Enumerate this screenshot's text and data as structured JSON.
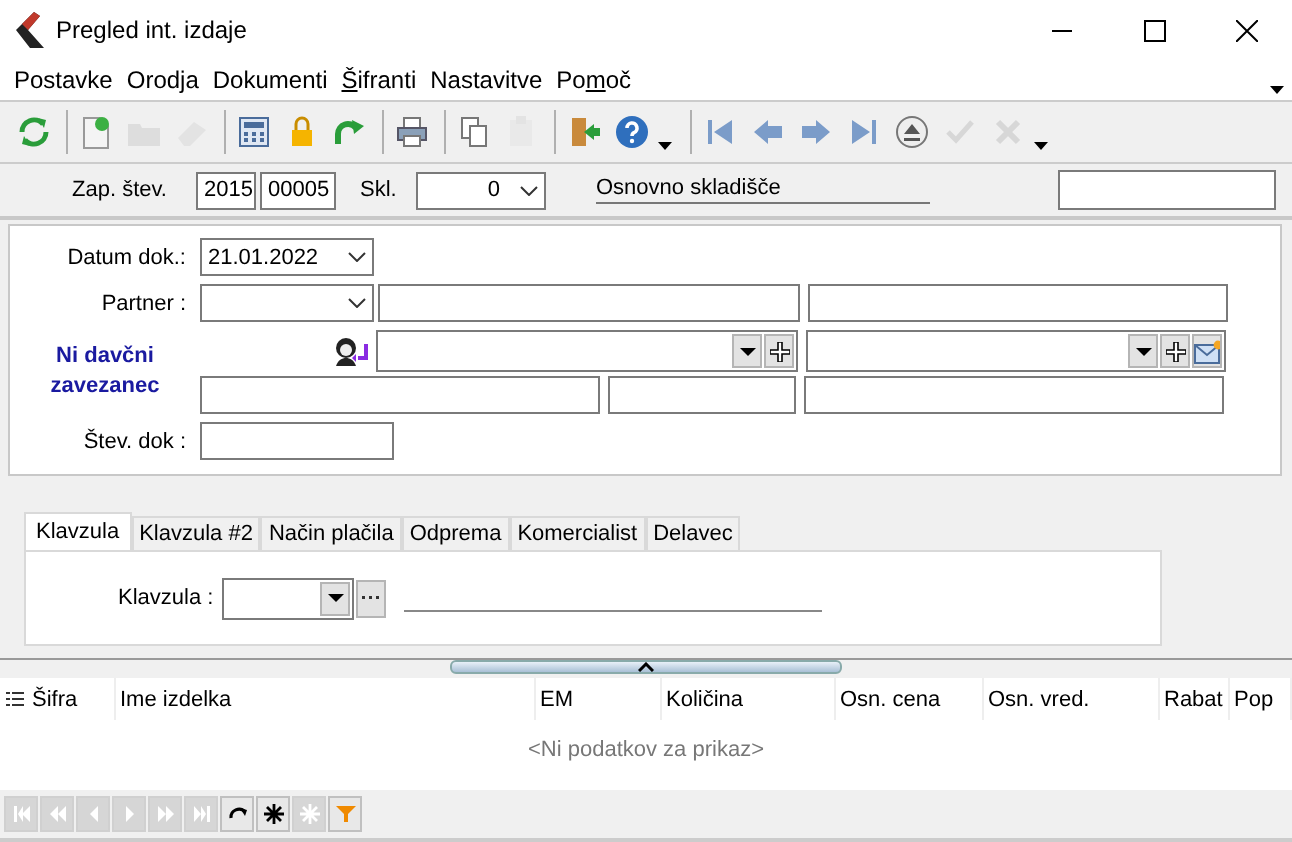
{
  "window": {
    "title": "Pregled int. izdaje"
  },
  "menu": [
    {
      "label": "Postavke"
    },
    {
      "label": "Orodja"
    },
    {
      "label": "Dokumenti"
    },
    {
      "segments": [
        {
          "text": "Š",
          "underlined": true
        },
        {
          "text": "ifranti",
          "underlined": false
        }
      ]
    },
    {
      "label": "Nastavitve"
    },
    {
      "segments": [
        {
          "text": "Po",
          "underlined": false
        },
        {
          "text": "m",
          "underlined": true
        },
        {
          "text": "oč",
          "underlined": false
        }
      ]
    }
  ],
  "toolbar": [
    {
      "disabled": false
    },
    {
      "disabled": false
    },
    {
      "disabled": true
    },
    {
      "disabled": true
    },
    {
      "disabled": false
    },
    {
      "disabled": false
    },
    {
      "disabled": false
    },
    {
      "disabled": false
    },
    {
      "disabled": false
    },
    {
      "disabled": true
    },
    {
      "disabled": false
    },
    {
      "disabled": false
    },
    {
      "disabled": false
    },
    {
      "disabled": false
    },
    {
      "disabled": false
    },
    {
      "disabled": false
    },
    {
      "disabled": false
    },
    {
      "disabled": true
    },
    {
      "disabled": true
    }
  ],
  "header": {
    "number_label": "Zap. štev.",
    "year": "2015",
    "number": "00005",
    "warehouse_label": "Skl.",
    "warehouse_code": "0",
    "warehouse_name": "Osnovno skladišče"
  },
  "form": {
    "date_label": "Datum dok.:",
    "date": "21.01.2022",
    "partner_label": "Partner :",
    "tax_status": "Ni davčni zavezanec",
    "doc_number_label": "Štev. dok :"
  },
  "tabs": [
    {
      "label": "Klavzula",
      "selected": true
    },
    {
      "label": "Klavzula #2",
      "selected": false
    },
    {
      "label": "Način plačila",
      "selected": false
    },
    {
      "label": "Odprema",
      "selected": false
    },
    {
      "label": "Komercialist",
      "selected": false
    },
    {
      "label": "Delavec",
      "selected": false
    }
  ],
  "clause_label": "Klavzula :",
  "table": {
    "columns": [
      "Šifra",
      "Ime izdelka",
      "EM",
      "Količina",
      "Osn. cena",
      "Osn. vred.",
      "Rabat",
      "Pop"
    ],
    "empty_message": "<Ni podatkov za prikaz>"
  },
  "navigator": [
    {
      "disabled": true
    },
    {
      "disabled": true
    },
    {
      "disabled": true
    },
    {
      "disabled": true
    },
    {
      "disabled": true
    },
    {
      "disabled": true
    },
    {
      "disabled": false
    },
    {
      "disabled": false
    },
    {
      "disabled": true
    },
    {
      "disabled": false
    }
  ]
}
